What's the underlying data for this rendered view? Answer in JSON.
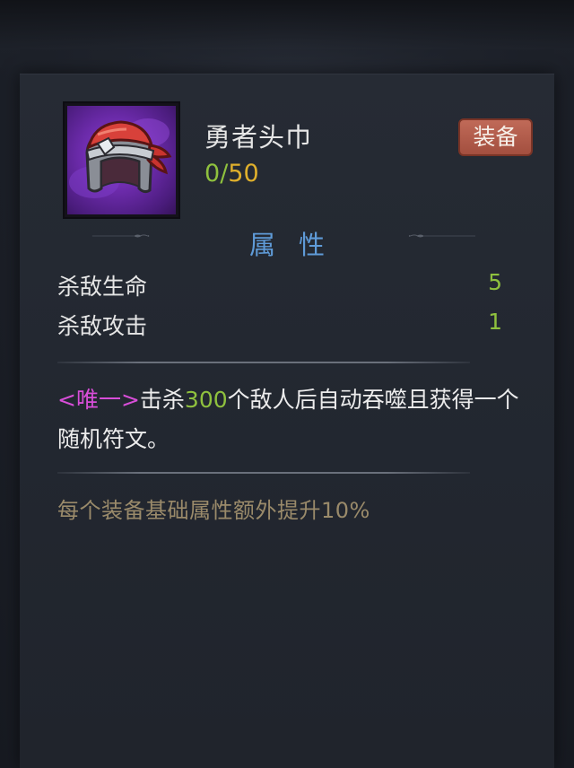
{
  "item": {
    "name": "勇者头巾",
    "count_current": "0",
    "count_separator": "/",
    "count_max": "50",
    "icon": "red-bandana-helmet-icon",
    "rarity_color": "#6a2aa8"
  },
  "equip_button": {
    "label": "装备"
  },
  "attributes": {
    "title": "属性",
    "rows": [
      {
        "label": "杀敌生命",
        "value": "5"
      },
      {
        "label": "杀敌攻击",
        "value": "1"
      }
    ]
  },
  "description": {
    "tag": "<唯一>",
    "text_before": "击杀",
    "number": "300",
    "text_after": "个敌人后自动吞噬且获得一个随机符文。"
  },
  "bonus": {
    "text": "每个装备基础属性额外提升10%"
  },
  "colors": {
    "accent_green": "#8fc13e",
    "accent_gold": "#e0b02c",
    "title_blue": "#5f9bd8",
    "unique_magenta": "#d84ed8",
    "button_red": "#a34f3f"
  }
}
